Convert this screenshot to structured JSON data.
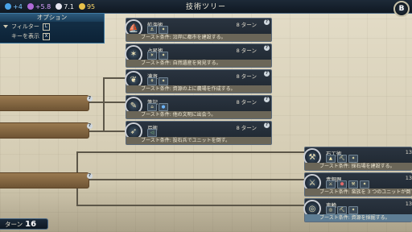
{
  "topbar": {
    "science": "+4",
    "culture": "+5.8",
    "faith": "7.1",
    "gold": "95",
    "title": "技術ツリー",
    "close_label": "B"
  },
  "options": {
    "header": "オプション",
    "filter_label": "フィルター",
    "filter_key": "L",
    "show_keys_label": "キーを表示",
    "show_keys_key": "X"
  },
  "cards": [
    {
      "name": "航海術",
      "turns": "8 ターン",
      "boost": "ブースト条件: 沿岸に都市を建設する。",
      "icon": "⛵"
    },
    {
      "name": "占星術",
      "turns": "8 ターン",
      "boost": "ブースト条件: 自然遺産を発見する。",
      "icon": "✶"
    },
    {
      "name": "灌漑",
      "turns": "8 ターン",
      "boost": "ブースト条件: 資源の上に農場を作成する。",
      "icon": "❦"
    },
    {
      "name": "筆記",
      "turns": "8 ターン",
      "boost": "ブースト条件: 他の文明に出会う。",
      "icon": "✎"
    },
    {
      "name": "弓術",
      "turns": "8 ターン",
      "boost": "ブースト条件: 投石兵でユニットを倒す。",
      "icon": "➶"
    },
    {
      "name": "石工術",
      "turns": "13",
      "boost": "ブースト条件: 採石場を建設する。",
      "icon": "⚒"
    },
    {
      "name": "青銅器",
      "turns": "13",
      "boost": "ブースト条件: 蛮族を 3 つのユニットが倒す。",
      "icon": "⚔"
    },
    {
      "name": "車輪",
      "turns": "13",
      "boost": "ブースト条件: 資源を採掘する。",
      "icon": "◎"
    }
  ],
  "turn": {
    "label": "ターン",
    "number": "16"
  }
}
